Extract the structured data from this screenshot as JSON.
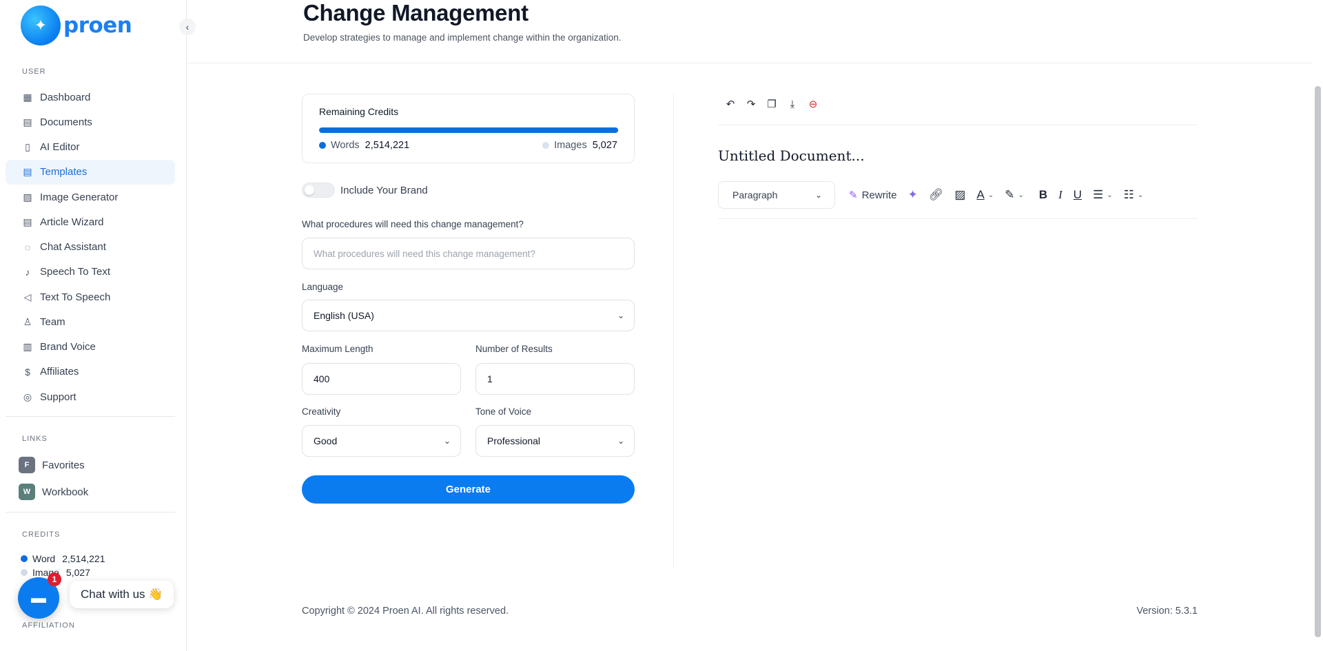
{
  "brand": {
    "name": "proen",
    "mark_icon": "sparkle-icon"
  },
  "sidebar": {
    "user_section": "USER",
    "items": [
      {
        "label": "Dashboard",
        "icon": "grid-icon",
        "glyph": "▦"
      },
      {
        "label": "Documents",
        "icon": "archive-icon",
        "glyph": "▤"
      },
      {
        "label": "AI Editor",
        "icon": "book-icon",
        "glyph": "▯"
      },
      {
        "label": "Templates",
        "icon": "file-text-icon",
        "glyph": "▤",
        "active": true
      },
      {
        "label": "Image Generator",
        "icon": "image-icon",
        "glyph": "▨"
      },
      {
        "label": "Article Wizard",
        "icon": "file-edit-icon",
        "glyph": "▤"
      },
      {
        "label": "Chat Assistant",
        "icon": "chat-icon",
        "glyph": "◌"
      },
      {
        "label": "Speech To Text",
        "icon": "microphone-icon",
        "glyph": "♪"
      },
      {
        "label": "Text To Speech",
        "icon": "speaker-icon",
        "glyph": "◁"
      },
      {
        "label": "Team",
        "icon": "user-plus-icon",
        "glyph": "♙"
      },
      {
        "label": "Brand Voice",
        "icon": "layout-icon",
        "glyph": "▥"
      },
      {
        "label": "Affiliates",
        "icon": "dollar-icon",
        "glyph": "$"
      },
      {
        "label": "Support",
        "icon": "lifebuoy-icon",
        "glyph": "◎"
      }
    ],
    "links_section": "LINKS",
    "links": [
      {
        "letter": "F",
        "label": "Favorites",
        "color": "#6b7280"
      },
      {
        "letter": "W",
        "label": "Workbook",
        "color": "#5b7f7a"
      }
    ],
    "credits_section": "CREDITS",
    "credits": [
      {
        "label": "Word",
        "value": "2,514,221",
        "color": "#0a6fdc"
      },
      {
        "label": "Image",
        "value": "5,027",
        "color": "#d1dbe6"
      }
    ],
    "affiliation_section": "AFFILIATION"
  },
  "chat_widget": {
    "label": "Chat with us 👋",
    "badge": "1"
  },
  "header": {
    "title": "Change Management",
    "subtitle": "Develop strategies to manage and implement change within the organization."
  },
  "form": {
    "credits_title": "Remaining Credits",
    "words_label": "Words",
    "words_value": "2,514,221",
    "images_label": "Images",
    "images_value": "5,027",
    "words_share": 0.998,
    "include_brand_label": "Include Your Brand",
    "procedures_label": "What procedures will need this change management?",
    "procedures_placeholder": "What procedures will need this change management?",
    "language_label": "Language",
    "language_value": "English (USA)",
    "max_length_label": "Maximum Length",
    "max_length_value": "400",
    "num_results_label": "Number of Results",
    "num_results_value": "1",
    "creativity_label": "Creativity",
    "creativity_value": "Good",
    "tone_label": "Tone of Voice",
    "tone_value": "Professional",
    "generate_label": "Generate"
  },
  "editor": {
    "doc_title": "Untitled Document...",
    "paragraph_label": "Paragraph",
    "rewrite_label": "Rewrite"
  },
  "footer": {
    "copyright": "Copyright © 2024 Proen AI. All rights reserved.",
    "version": "Version: 5.3.1"
  }
}
